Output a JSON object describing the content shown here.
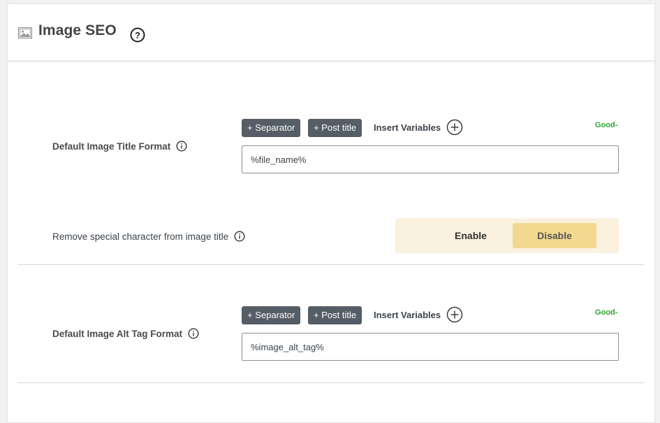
{
  "header": {
    "title": "Image SEO",
    "icon": "image-icon",
    "help_icon": "question-circle-icon"
  },
  "title_format": {
    "label": "Default Image Title Format",
    "separator_label": "+ Separator",
    "post_title_label": "+ Post title",
    "insert_variables_label": "Insert Variables",
    "status": "Good-",
    "value": "%file_name%"
  },
  "special_char": {
    "label": "Remove special character from image title",
    "enable_label": "Enable",
    "disable_label": "Disable",
    "selected": "Disable"
  },
  "alt_format": {
    "label": "Default Image Alt Tag Format",
    "separator_label": "+ Separator",
    "post_title_label": "+ Post title",
    "insert_variables_label": "Insert Variables",
    "status": "Good-",
    "value": "%image_alt_tag%"
  },
  "colors": {
    "chip_bg": "#555d66",
    "good_text": "#2ea52e",
    "toggle_bg": "#fbf1df",
    "toggle_selected": "#f3d98f"
  }
}
